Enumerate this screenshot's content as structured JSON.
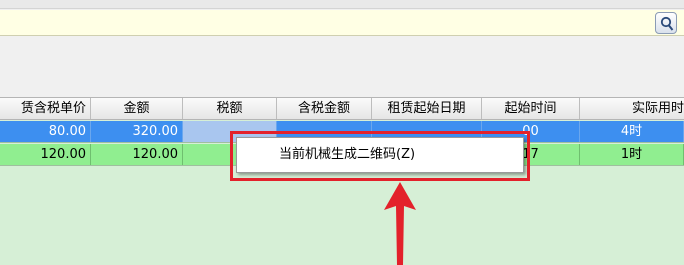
{
  "search": {
    "value": ""
  },
  "grid": {
    "columns": [
      "赁含税单价",
      "金额",
      "税额",
      "含税金额",
      "租赁起始日期",
      "起始时间",
      "实际用时"
    ],
    "rows": [
      [
        "80.00",
        "320.00",
        "",
        "",
        "",
        "00",
        "4时"
      ],
      [
        "120.00",
        "120.00",
        "",
        "",
        "",
        "17",
        "1时"
      ]
    ]
  },
  "context_menu": {
    "items": [
      "当前机械生成二维码(Z)"
    ]
  },
  "colors": {
    "selected_row": "#3d8ff0",
    "green_row": "#90ee90",
    "grid_background": "#d6efd6",
    "annotation": "#e3212b",
    "search_bar": "#ffffe4"
  },
  "icons": {
    "search_button": "search-icon"
  }
}
